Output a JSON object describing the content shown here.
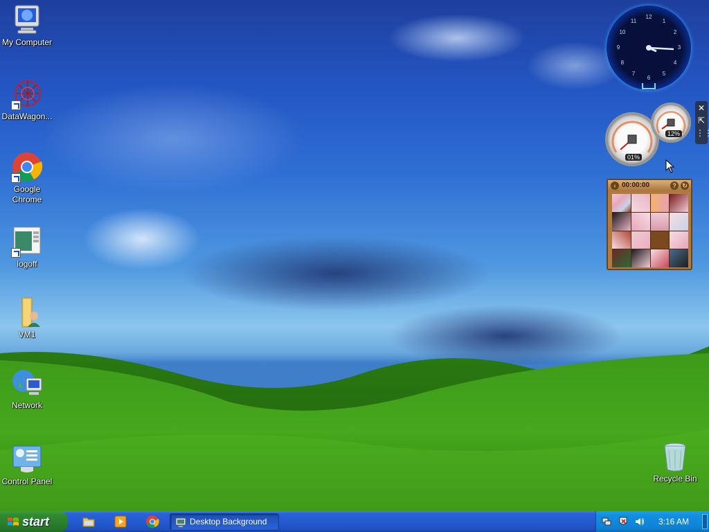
{
  "desktop": {
    "icons": [
      {
        "label": "My Computer",
        "icon": "my-computer-icon"
      },
      {
        "label": "DataWagon...",
        "icon": "datawagon-icon"
      },
      {
        "label": "Google Chrome",
        "icon": "chrome-icon"
      },
      {
        "label": "logoff",
        "icon": "logoff-icon"
      },
      {
        "label": "VM1",
        "icon": "user-folder-icon"
      },
      {
        "label": "Network",
        "icon": "network-icon"
      },
      {
        "label": "Control Panel",
        "icon": "control-panel-icon"
      },
      {
        "label": "Recycle Bin",
        "icon": "recycle-bin-icon"
      }
    ]
  },
  "gadgets": {
    "clock_numbers": [
      "12",
      "1",
      "2",
      "3",
      "4",
      "5",
      "6",
      "7",
      "8",
      "9",
      "10",
      "11"
    ],
    "cpu_meter": {
      "cpu": "01%",
      "memory": "12%"
    },
    "puzzle": {
      "timer": "00:00:00"
    },
    "tools": {
      "close": "✕",
      "options": "⇱",
      "drag": "⋮⋮"
    }
  },
  "taskbar": {
    "start_label": "start",
    "task_button": "Desktop Background",
    "clock": "3:16 AM"
  },
  "colors": {
    "taskbar": "#245bd1",
    "start": "#2f8a2f",
    "tray": "#0f82d4"
  }
}
